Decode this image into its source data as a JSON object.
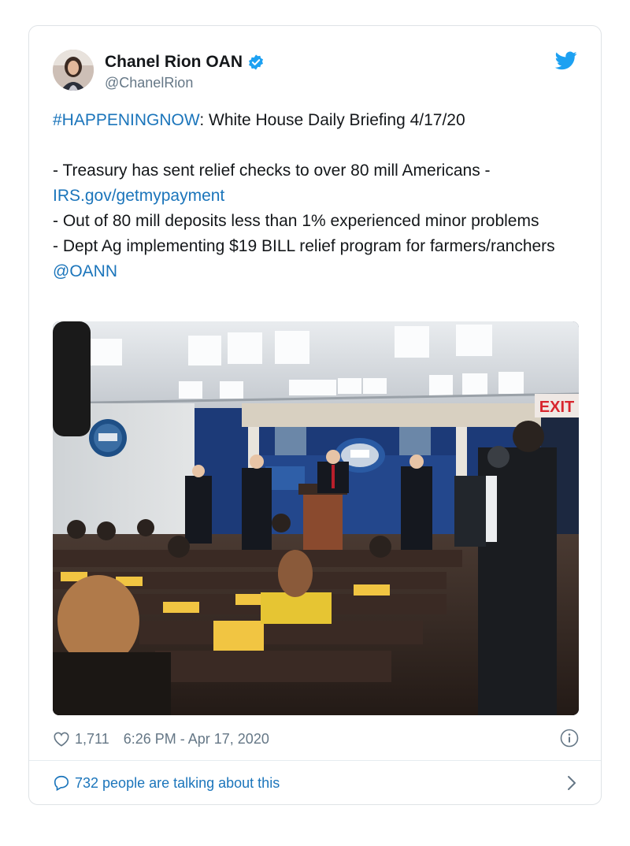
{
  "author": {
    "display_name": "Chanel Rion OAN",
    "handle": "@ChanelRion",
    "verified": true
  },
  "tweet": {
    "line1_hashtag": "#HAPPENINGNOW",
    "line1_rest": ": White House Daily  Briefing 4/17/20",
    "line2": "- Treasury has sent relief checks to over 80 mill Americans -",
    "line2_link": "IRS.gov/getmypayment",
    "line3": "- Out of 80 mill deposits less than 1% experienced minor problems",
    "line4": "- Dept Ag implementing $19 BILL relief program for farmers/ranchers ",
    "line4_mention": "@OANN"
  },
  "photo": {
    "exit_sign": "EXIT"
  },
  "meta": {
    "likes": "1,711",
    "timestamp": "6:26 PM - Apr 17, 2020"
  },
  "footer": {
    "talking_label": "732 people are talking about this"
  },
  "colors": {
    "link": "#1b75bb",
    "twitter_blue": "#1da1f2",
    "text": "#14171a",
    "muted": "#657786"
  },
  "icons": [
    "verified-badge-icon",
    "twitter-bird-icon",
    "heart-icon",
    "info-icon",
    "reply-bubble-icon",
    "chevron-right-icon"
  ]
}
